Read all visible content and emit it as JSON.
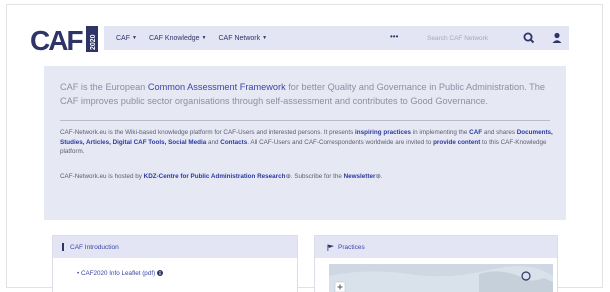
{
  "logo": {
    "text": "CAF",
    "year": "2020"
  },
  "navbar": {
    "items": [
      {
        "label": "CAF"
      },
      {
        "label": "CAF Knowledge"
      },
      {
        "label": "CAF Network"
      }
    ],
    "more_label": "•••",
    "search_placeholder": "Search CAF Network"
  },
  "intro": {
    "lead_1": "CAF is the European ",
    "lead_hl": "Common Assessment Framework",
    "lead_2": " for better Quality and Governance in Public Administration. The CAF improves public sector organisations through self-assessment and contributes to Good Governance.",
    "p1": {
      "t1": "CAF-Network.eu is the Wiki-based knowledge platform for CAF-Users and interested persons. It presents ",
      "l1": "inspiring practices",
      "t2": " in implementing the ",
      "l2": "CAF",
      "t3": " and shares ",
      "l3": "Documents, Studies, Articles, Digital CAF Tools, Social Media",
      "t4": " and ",
      "l4": "Contacts",
      "t5": ". All CAF-Users and CAF-Correspondents worldwide are invited to ",
      "l5": "provide content",
      "t6": " to this CAF-Knowledge platform."
    },
    "p2": {
      "t1": "CAF-Network.eu is hosted by ",
      "l1": "KDZ-Centre for Public Administration Research",
      "t2": "⊕. Subscribe for the ",
      "l2": "Newsletter",
      "t3": "⊕."
    }
  },
  "cards": {
    "left": {
      "title": "CAF Introduction",
      "item": "• CAF2020 Info Leaflet (pdf)"
    },
    "right": {
      "title": "Practices"
    }
  },
  "colors": {
    "brand": "#2e3566",
    "accent": "#3b45a8",
    "panel": "#e6e8f3",
    "nav": "#e3e5f4"
  }
}
